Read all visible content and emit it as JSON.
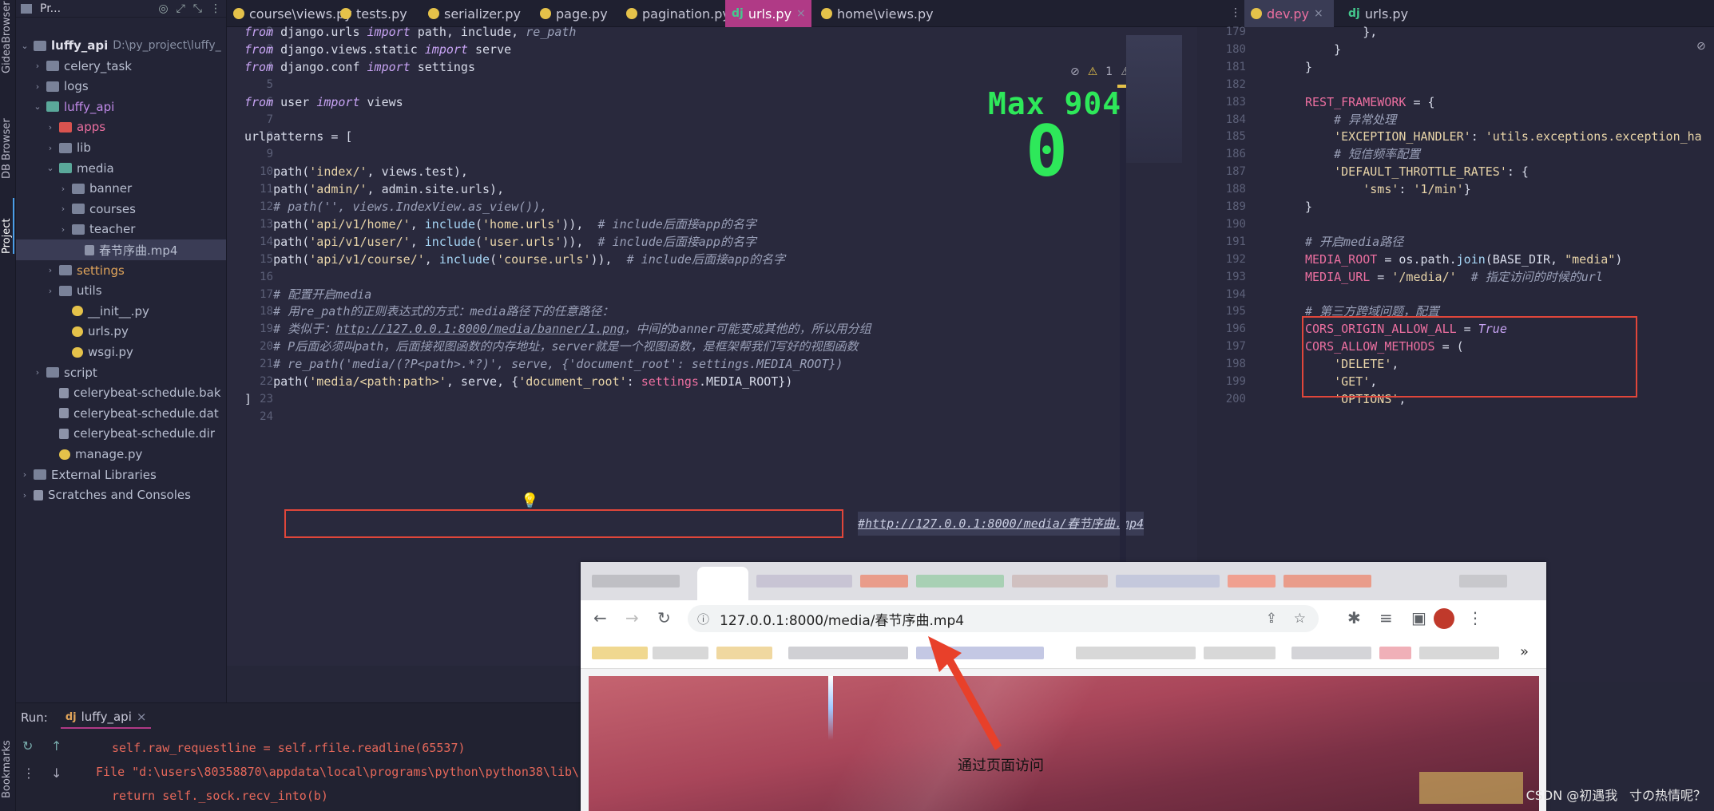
{
  "left_strip": {
    "labels": [
      "GideaBrowser",
      "DB Browser",
      "Project",
      "Bookmarks"
    ]
  },
  "project": {
    "header": "Pr...",
    "tree": [
      {
        "label": "luffy_api",
        "hint": "D:\\py_project\\luffy_",
        "icon": "folder-icon",
        "arrow": "v",
        "indent": 0,
        "color": "bold"
      },
      {
        "label": "celery_task",
        "icon": "folder-icon",
        "arrow": ">",
        "indent": 1
      },
      {
        "label": "logs",
        "icon": "folder-icon",
        "arrow": ">",
        "indent": 1
      },
      {
        "label": "luffy_api",
        "icon": "folder-icon",
        "arrow": "v",
        "indent": 1,
        "color": "purple"
      },
      {
        "label": "apps",
        "icon": "folder-icon",
        "arrow": ">",
        "indent": 2,
        "color": "pink"
      },
      {
        "label": "lib",
        "icon": "folder-icon",
        "arrow": ">",
        "indent": 2
      },
      {
        "label": "media",
        "icon": "folder-icon",
        "arrow": "v",
        "indent": 2
      },
      {
        "label": "banner",
        "icon": "folder-icon",
        "arrow": ">",
        "indent": 3
      },
      {
        "label": "courses",
        "icon": "folder-icon",
        "arrow": ">",
        "indent": 3
      },
      {
        "label": "teacher",
        "icon": "folder-icon",
        "arrow": ">",
        "indent": 3
      },
      {
        "label": "春节序曲.mp4",
        "icon": "video-file-icon",
        "arrow": "",
        "indent": 4,
        "selected": true
      },
      {
        "label": "settings",
        "icon": "folder-icon",
        "arrow": ">",
        "indent": 2,
        "color": "orange"
      },
      {
        "label": "utils",
        "icon": "folder-icon",
        "arrow": ">",
        "indent": 2
      },
      {
        "label": "__init__.py",
        "icon": "python-file-icon",
        "arrow": "",
        "indent": 3
      },
      {
        "label": "urls.py",
        "icon": "python-file-icon",
        "arrow": "",
        "indent": 3
      },
      {
        "label": "wsgi.py",
        "icon": "python-file-icon",
        "arrow": "",
        "indent": 3
      },
      {
        "label": "script",
        "icon": "folder-icon",
        "arrow": ">",
        "indent": 1
      },
      {
        "label": "celerybeat-schedule.bak",
        "icon": "file-icon",
        "arrow": "",
        "indent": 2
      },
      {
        "label": "celerybeat-schedule.dat",
        "icon": "file-icon",
        "arrow": "",
        "indent": 2
      },
      {
        "label": "celerybeat-schedule.dir",
        "icon": "file-icon",
        "arrow": "",
        "indent": 2
      },
      {
        "label": "manage.py",
        "icon": "python-file-icon",
        "arrow": "",
        "indent": 2
      },
      {
        "label": "External Libraries",
        "icon": "library-icon",
        "arrow": ">",
        "indent": 0
      },
      {
        "label": "Scratches and Consoles",
        "icon": "scratch-icon",
        "arrow": ">",
        "indent": 0
      }
    ]
  },
  "tabs": [
    {
      "label": "course\\views.py",
      "type": "py"
    },
    {
      "label": "tests.py",
      "type": "py"
    },
    {
      "label": "serializer.py",
      "type": "py"
    },
    {
      "label": "page.py",
      "type": "py"
    },
    {
      "label": "pagination.py",
      "type": "py"
    },
    {
      "label": "urls.py",
      "type": "dj",
      "active": true
    },
    {
      "label": "home\\views.py",
      "type": "py"
    },
    {
      "label": "dev.py",
      "type": "py",
      "right_active": true
    },
    {
      "label": "urls.py",
      "type": "dj"
    }
  ],
  "editor": {
    "line_numbers": [
      "2",
      "3",
      "4",
      "5",
      "6",
      "7",
      "8",
      "9",
      "10",
      "11",
      "12",
      "13",
      "14",
      "15",
      "16",
      "17",
      "18",
      "19",
      "20",
      "21",
      "22",
      "23",
      "24"
    ],
    "max_label": "Max 904",
    "counter": "0",
    "inline_hint": "#http://127.0.0.1:8000/media/春节序曲.mp4",
    "warnings": "1",
    "warnings2": "1",
    "lines": [
      [
        [
          "kw",
          "from"
        ],
        [
          "gy",
          " django.urls "
        ],
        [
          "kw",
          "import"
        ],
        [
          "gy",
          " path, include, "
        ],
        [
          "cm",
          "re_path"
        ]
      ],
      [
        [
          "kw",
          "from"
        ],
        [
          "gy",
          " django.views.static "
        ],
        [
          "kw",
          "import"
        ],
        [
          "gy",
          " serve"
        ]
      ],
      [
        [
          "kw",
          "from"
        ],
        [
          "gy",
          " django.conf "
        ],
        [
          "kw",
          "import"
        ],
        [
          "gy",
          " settings"
        ]
      ],
      [],
      [
        [
          "kw",
          "from"
        ],
        [
          "gy",
          " user "
        ],
        [
          "kw",
          "import"
        ],
        [
          "gy",
          " views"
        ]
      ],
      [],
      [
        [
          "gy",
          "urlpatterns = ["
        ]
      ],
      [],
      [
        [
          "gy",
          "    path("
        ],
        [
          "str",
          "'index/'"
        ],
        [
          "gy",
          ", views.test),"
        ]
      ],
      [
        [
          "gy",
          "    path("
        ],
        [
          "str",
          "'admin/'"
        ],
        [
          "gy",
          ", admin.site.urls),"
        ]
      ],
      [
        [
          "cm",
          "    # path('', views.IndexView.as_view()),"
        ]
      ],
      [
        [
          "gy",
          "    path("
        ],
        [
          "str",
          "'api/v1/home/'"
        ],
        [
          "gy",
          ", "
        ],
        [
          "fn",
          "include"
        ],
        [
          "gy",
          "("
        ],
        [
          "str",
          "'home.urls'"
        ],
        [
          "gy",
          ")),  "
        ],
        [
          "cm",
          "# include后面接app的名字"
        ]
      ],
      [
        [
          "gy",
          "    path("
        ],
        [
          "str",
          "'api/v1/user/'"
        ],
        [
          "gy",
          ", "
        ],
        [
          "fn",
          "include"
        ],
        [
          "gy",
          "("
        ],
        [
          "str",
          "'user.urls'"
        ],
        [
          "gy",
          ")),  "
        ],
        [
          "cm",
          "# include后面接app的名字"
        ]
      ],
      [
        [
          "gy",
          "    path("
        ],
        [
          "str",
          "'api/v1/course/'"
        ],
        [
          "gy",
          ", "
        ],
        [
          "fn",
          "include"
        ],
        [
          "gy",
          "("
        ],
        [
          "str",
          "'course.urls'"
        ],
        [
          "gy",
          ")),  "
        ],
        [
          "cm",
          "# include后面接app的名字"
        ]
      ],
      [],
      [
        [
          "cm",
          "    # 配置开启media"
        ]
      ],
      [
        [
          "cm",
          "    # 用re_path的正则表达式的方式：media路径下的任意路径："
        ]
      ],
      [
        [
          "cm",
          "    # 类似于："
        ],
        [
          "url",
          "http://127.0.0.1:8000/media/banner/1.png"
        ],
        [
          "cm",
          "，中间的banner可能变成其他的，所以用分组"
        ]
      ],
      [
        [
          "cm",
          "    # P后面必须叫path，后面接视图函数的内存地址，server就是一个视图函数，是框架帮我们写好的视图函数"
        ]
      ],
      [
        [
          "cm",
          "    # re_path('media/(?P<path>.*?)', serve, {'document_root': settings.MEDIA_ROOT})"
        ]
      ],
      [
        [
          "gy",
          "    path("
        ],
        [
          "str",
          "'media/<path:path>'"
        ],
        [
          "gy",
          ", serve, {"
        ],
        [
          "str",
          "'document_root'"
        ],
        [
          "gy",
          ": "
        ],
        [
          "pk",
          "settings"
        ],
        [
          "gy",
          ".MEDIA_ROOT})"
        ]
      ],
      [
        [
          "gy",
          "]"
        ]
      ],
      []
    ]
  },
  "right_editor": {
    "line_numbers": [
      "179",
      "180",
      "181",
      "182",
      "183",
      "184",
      "185",
      "186",
      "187",
      "188",
      "189",
      "190",
      "191",
      "192",
      "193",
      "194",
      "195",
      "196",
      "197",
      "198",
      "199",
      "200"
    ],
    "lines": [
      [
        [
          "gy",
          "        },"
        ]
      ],
      [
        [
          "gy",
          "    }"
        ]
      ],
      [
        [
          "gy",
          "}"
        ]
      ],
      [],
      [
        [
          "pk",
          "REST_FRAMEWORK"
        ],
        [
          "gy",
          " = {"
        ]
      ],
      [
        [
          "cm",
          "    # 异常处理"
        ]
      ],
      [
        [
          "str",
          "    'EXCEPTION_HANDLER'"
        ],
        [
          "gy",
          ": "
        ],
        [
          "str",
          "'utils.exceptions.exception_ha"
        ]
      ],
      [
        [
          "cm",
          "    # 短信频率配置"
        ]
      ],
      [
        [
          "str",
          "    'DEFAULT_THROTTLE_RATES'"
        ],
        [
          "gy",
          ": {"
        ]
      ],
      [
        [
          "str",
          "        'sms'"
        ],
        [
          "gy",
          ": "
        ],
        [
          "str",
          "'1/min'"
        ],
        [
          "gy",
          "}"
        ]
      ],
      [
        [
          "gy",
          "}"
        ]
      ],
      [],
      [
        [
          "cm",
          "# 开启media路径"
        ]
      ],
      [
        [
          "pk",
          "MEDIA_ROOT"
        ],
        [
          "gy",
          " = os.path."
        ],
        [
          "fn",
          "join"
        ],
        [
          "gy",
          "(BASE_DIR, "
        ],
        [
          "str",
          "\"media\""
        ],
        [
          "gy",
          ")"
        ]
      ],
      [
        [
          "pk",
          "MEDIA_URL"
        ],
        [
          "gy",
          " = "
        ],
        [
          "str",
          "'/media/'"
        ],
        [
          "gy",
          "  "
        ],
        [
          "cm",
          "# 指定访问的时候的url"
        ]
      ],
      [],
      [
        [
          "cm",
          "# 第三方跨域问题，配置"
        ]
      ],
      [
        [
          "pk",
          "CORS_ORIGIN_ALLOW_ALL"
        ],
        [
          "gy",
          " = "
        ],
        [
          "kw",
          "True"
        ]
      ],
      [
        [
          "pk",
          "CORS_ALLOW_METHODS"
        ],
        [
          "gy",
          " = ("
        ]
      ],
      [
        [
          "str",
          "    'DELETE'"
        ],
        [
          "gy",
          ","
        ]
      ],
      [
        [
          "str",
          "    'GET'"
        ],
        [
          "gy",
          ","
        ]
      ],
      [
        [
          "str",
          "    'OPTIONS'"
        ],
        [
          "gy",
          ","
        ]
      ]
    ]
  },
  "run": {
    "label": "Run:",
    "tab": "luffy_api",
    "lines": [
      "self.raw_requestline = self.rfile.readline(65537)",
      "File \"d:\\users\\80358870\\appdata\\local\\programs\\python\\python38\\lib\\",
      "return self._sock.recv_into(b)"
    ]
  },
  "browser": {
    "url": "127.0.0.1:8000/media/春节序曲.mp4",
    "more": "»"
  },
  "caption": "通过页面访问",
  "watermark": "CSDN @初遇我ㅤ寸の热情呢？",
  "colors": {
    "accent": "#b03a86",
    "highlight_box": "#e0463a",
    "counter": "#2ee85a"
  }
}
